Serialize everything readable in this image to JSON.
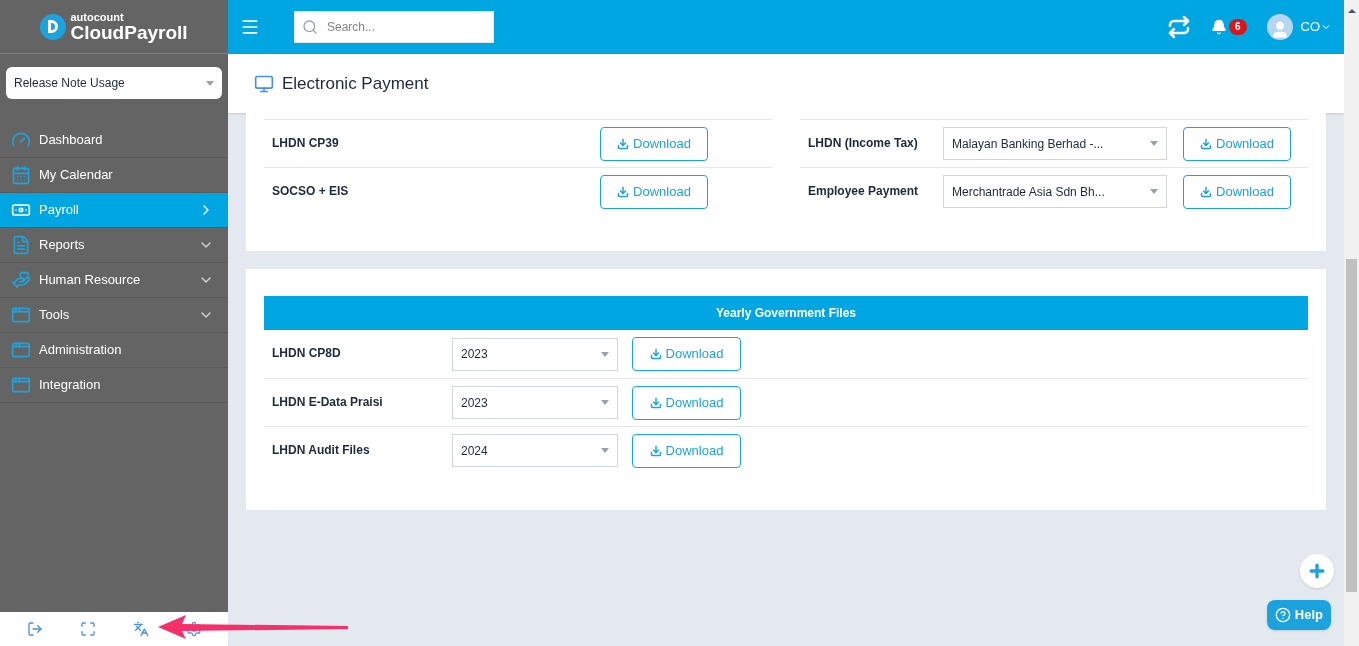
{
  "logo": {
    "brand_small": "autocount",
    "brand": "CloudPayroll"
  },
  "company_select": {
    "value": "Release Note Usage"
  },
  "sidebar": {
    "items": [
      {
        "label": "Dashboard",
        "selected": false
      },
      {
        "label": "My Calendar",
        "selected": false
      },
      {
        "label": "Payroll",
        "selected": true,
        "expandable": true
      },
      {
        "label": "Reports",
        "selected": false,
        "expandable": true
      },
      {
        "label": "Human Resource",
        "selected": false,
        "expandable": true
      },
      {
        "label": "Tools",
        "selected": false,
        "expandable": true
      },
      {
        "label": "Administration",
        "selected": false
      },
      {
        "label": "Integration",
        "selected": false
      }
    ]
  },
  "topbar": {
    "search": {
      "placeholder": "Search..."
    },
    "notifications": "6",
    "user": "CO"
  },
  "page_title": "Electronic Payment",
  "monthly_files": {
    "left": [
      {
        "label": "LHDN CP39",
        "button": "Download"
      },
      {
        "label": "SOCSO + EIS",
        "button": "Download"
      }
    ],
    "right": [
      {
        "label": "LHDN (Income Tax)",
        "select": "Malayan Banking Berhad -...",
        "button": "Download"
      },
      {
        "label": "Employee Payment",
        "select": "Merchantrade Asia Sdn Bh...",
        "button": "Download"
      }
    ]
  },
  "yearly_files": {
    "title": "Yearly Government Files",
    "rows": [
      {
        "label": "LHDN CP8D",
        "year": "2023",
        "button": "Download"
      },
      {
        "label": "LHDN E-Data Praisi",
        "year": "2023",
        "button": "Download"
      },
      {
        "label": "LHDN Audit Files",
        "year": "2024",
        "button": "Download"
      }
    ]
  },
  "help": "Help"
}
